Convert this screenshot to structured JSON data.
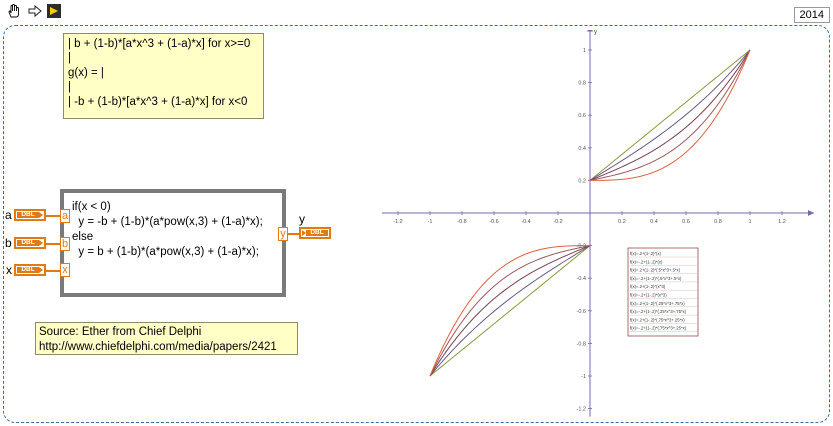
{
  "toolbar": {
    "icons": [
      "hand-tool-icon",
      "run-arrow-icon",
      "highlight-execution-icon"
    ],
    "version": "2014"
  },
  "formula_lines": [
    "| b + (1-b)*[a*x^3 + (1-a)*x] for x>=0",
    "|",
    "g(x) = |",
    "|",
    "| -b + (1-b)*[a*x^3 + (1-a)*x] for x<0"
  ],
  "formula_node": {
    "code_lines": [
      "if(x < 0)",
      "  y = -b + (1-b)*(a*pow(x,3) + (1-a)*x);",
      "else",
      "  y = b + (1-b)*(a*pow(x,3) + (1-a)*x);"
    ],
    "inputs": [
      {
        "control_label": "a",
        "type": "DBL",
        "terminal": "a"
      },
      {
        "control_label": "b",
        "type": "DBL",
        "terminal": "b"
      },
      {
        "control_label": "x",
        "type": "DBL",
        "terminal": "x"
      }
    ],
    "output": {
      "terminal": "y",
      "indicator_label": "y",
      "type": "DBL"
    }
  },
  "source": {
    "line1": "Source: Ether from Chief Delphi",
    "line2": "http://www.chiefdelphi.com/media/papers/2421"
  },
  "chart_data": {
    "type": "line",
    "title": "",
    "xlabel": "",
    "ylabel": "y",
    "xlim": [
      -1.3,
      1.4
    ],
    "ylim": [
      -1.25,
      1.15
    ],
    "x_ticks": [
      "-1.2",
      "-1",
      "-0.8",
      "-0.6",
      "-0.4",
      "-0.2",
      "0",
      "0.2",
      "0.4",
      "0.6",
      "0.8",
      "1",
      "1.2"
    ],
    "y_ticks": [
      "1",
      "0.8",
      "0.6",
      "0.4",
      "0.2",
      "0",
      "-0.2",
      "-0.4",
      "-0.6",
      "-0.8",
      "-1",
      "-1.2"
    ],
    "grid": false,
    "legend_placement": "lower-right",
    "b": 0.2,
    "colors": [
      "#8b9a3d",
      "#6b5a8a",
      "#7a4050",
      "#9a5a5a",
      "#e06040"
    ],
    "series": [
      {
        "name": "f(x)=.2+(1-.2)*(x)",
        "a": 0
      },
      {
        "name": "f(x)=.2+(1-.2)*(x)",
        "a": 0.25
      },
      {
        "name": "f(x)=.2+(1-.2)*(.5*x^3+.5*x)",
        "a": 0.5
      },
      {
        "name": "f(x)=.2+(1-.2)*(x^3)",
        "a": 0.75
      },
      {
        "name": "f(x)=-.2+(1-.2)*(x^3)",
        "a": 1
      }
    ],
    "legend_entries": [
      "f(x)=.2+(1-.2)*(x)",
      "f(x)=-.2+(1-.2)*(x)",
      "f(x)=.2+(1-.2)*(.5*x^3+.5*x)",
      "f(x)=-.2+(1-.2)*(.5*x^3+.5*x)",
      "f(x)=.2+(1-.2)*(x^3)",
      "f(x)=-.2+(1-.2)*(x^3)",
      "f(x)=.2+(1-.2)*(.25*x^3+.75*x)",
      "f(x)=-.2+(1-.2)*(.25*x^3+.75*x)",
      "f(x)=.2+(1-.2)*(.75*x^3+.25*x)",
      "f(x)=-.2+(1-.2)*(.75*x^3+.25*x)"
    ]
  }
}
